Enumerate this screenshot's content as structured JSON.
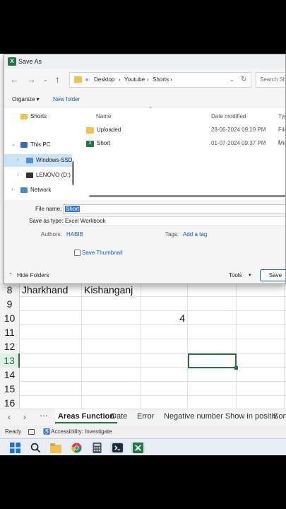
{
  "dialog": {
    "title": "Save As",
    "address_path": [
      "«",
      "Desktop",
      "›",
      "Youtube",
      "›",
      "Shorts",
      "›"
    ],
    "search_placeholder": "Search Sho",
    "organize": "Organize ▾",
    "new_folder": "New folder",
    "tree": [
      {
        "label": "Shorts",
        "icon": "folder-icon"
      },
      {
        "label": "This PC",
        "icon": "computer-icon"
      },
      {
        "label": "Windows-SSD",
        "icon": "drive-icon"
      },
      {
        "label": "LENOVO (D:)",
        "icon": "drive-icon"
      },
      {
        "label": "Network",
        "icon": "network-icon"
      }
    ],
    "columns": {
      "name": "Name",
      "date": "Date modified",
      "type": "Type"
    },
    "files": [
      {
        "name": "Uploaded",
        "date": "28-06-2024 09:19 PM",
        "type": "File f",
        "icon": "folder-icon"
      },
      {
        "name": "Short",
        "date": "01-07-2024 09:37 PM",
        "type": "Micr",
        "icon": "excel-file-icon"
      }
    ],
    "file_name_label": "File name:",
    "file_name_value": "Short",
    "save_type_label": "Save as type:",
    "save_type_value": "Excel Workbook",
    "authors_label": "Authors:",
    "authors_value": "HABIB",
    "tags_label": "Tags:",
    "tags_value": "Add a tag",
    "thumbnail_label": "Save Thumbnail",
    "hide_folders": "Hide Folders",
    "tools": "Tools",
    "save": "Save"
  },
  "sheet": {
    "rows": [
      {
        "num": "8",
        "a": "Jharkhand",
        "b": "Kishanganj",
        "c": ""
      },
      {
        "num": "9",
        "a": "",
        "b": "",
        "c": ""
      },
      {
        "num": "10",
        "a": "",
        "b": "",
        "c": "4"
      },
      {
        "num": "11",
        "a": "",
        "b": "",
        "c": ""
      },
      {
        "num": "12",
        "a": "",
        "b": "",
        "c": ""
      },
      {
        "num": "13",
        "a": "",
        "b": "",
        "c": ""
      },
      {
        "num": "14",
        "a": "",
        "b": "",
        "c": ""
      },
      {
        "num": "15",
        "a": "",
        "b": "",
        "c": ""
      },
      {
        "num": "16",
        "a": "",
        "b": "",
        "c": ""
      }
    ],
    "selected_row": "13",
    "tabs": [
      "Areas Function",
      "Date",
      "Error",
      "Negative number Show in positiv",
      "Sort"
    ],
    "active_tab": "Areas Function",
    "status_ready": "Ready",
    "status_accessibility": "Accessibility: Investigate"
  },
  "colors": {
    "excel_green": "#217346",
    "accent": "#0067c0",
    "folder": "#f2c24d"
  }
}
